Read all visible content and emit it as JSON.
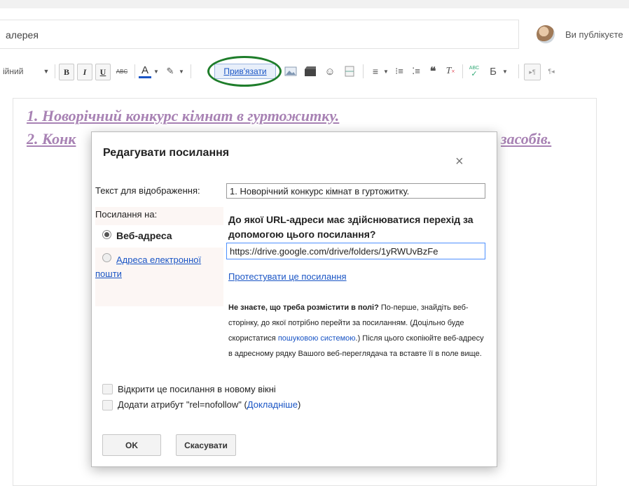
{
  "header": {
    "title_value": "алерея",
    "publish_text": "Ви публікуєте"
  },
  "toolbar": {
    "font_label": "ійний",
    "bold": "B",
    "italic": "I",
    "underline": "U",
    "strike": "ABC",
    "text_color": "A",
    "link_label": "Прив'язати",
    "spellcheck": "ABC",
    "script_label": "Б",
    "ltr": "▸¶",
    "rtl": "¶◂"
  },
  "editor": {
    "line1": "1. Новорічний конкурс кімнат в гуртожитку.",
    "line2_start": "2. Конк",
    "line2_end": "засобів."
  },
  "dialog": {
    "title": "Редагувати посилання",
    "close": "×",
    "display_label": "Текст для відображення:",
    "display_value": "1. Новорічний конкурс кімнат в гуртожитку.",
    "link_to_label": "Посилання на:",
    "option_web": "Веб-адреса",
    "option_email": "Адреса електронної пошти",
    "url_question": "До якої URL-адреси має здійснюватися перехід за допомогою цього посилання?",
    "url_value": "https://drive.google.com/drive/folders/1yRWUvBzFe",
    "test_link": "Протестувати це посилання",
    "help_bold": "Не знаєте, що треба розмістити в полі?",
    "help_1": " По-перше, знайдіть веб-сторінку, до якої потрібно перейти за посиланням. (Доцільно буде скористатися ",
    "help_link": "пошуковою системою",
    "help_2": ".) Після цього скопіюйте веб-адресу в адресному рядку Вашого веб-переглядача та вставте її в поле вище.",
    "new_window_label": "Відкрити це посилання в новому вікні",
    "nofollow_label": "Додати атрибут \"rel=nofollow\" (",
    "nofollow_link": "Докладніше",
    "nofollow_close": ")",
    "ok": "OK",
    "cancel": "Скасувати"
  },
  "colors": {
    "accent_link": "#1a55c5",
    "editor_text": "#a882b4",
    "highlight_ring": "#1e7d2a"
  }
}
